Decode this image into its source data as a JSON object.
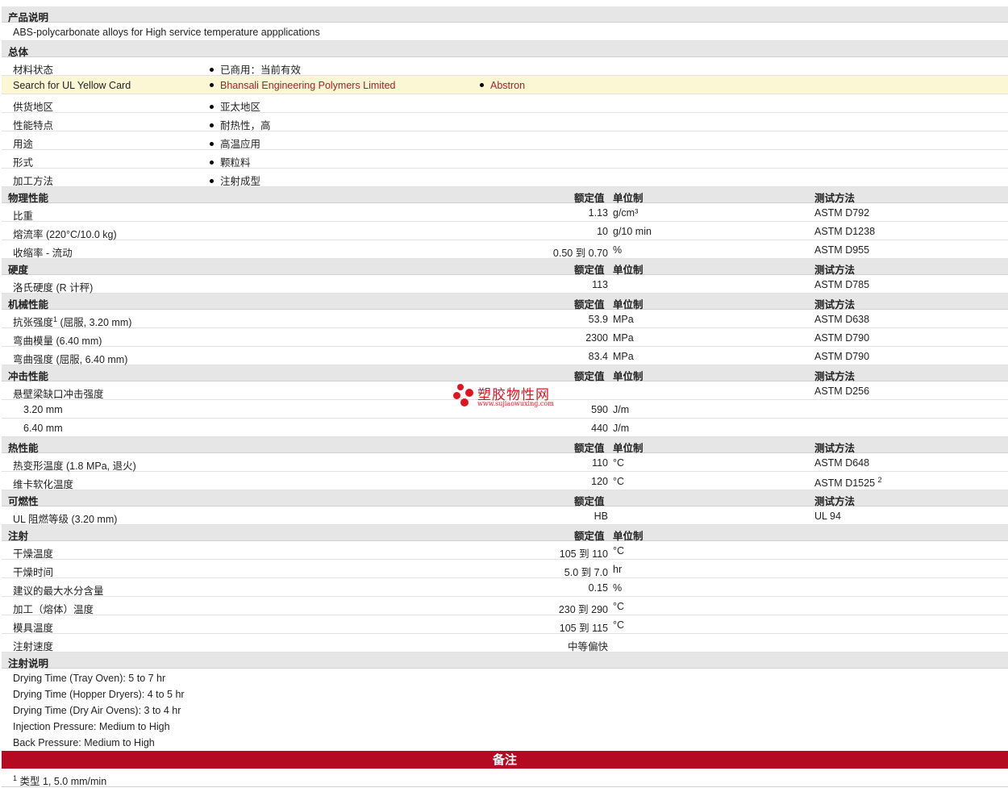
{
  "description": {
    "header": "产品说明",
    "text": "ABS-polycarbonate alloys for High service temperature appplications"
  },
  "general": {
    "header": "总体",
    "rows": [
      {
        "label": "材料状态",
        "b1": "已商用：当前有效"
      },
      {
        "label": "Search for UL Yellow Card",
        "b1": "Bhansali Engineering Polymers Limited",
        "b2": "Abstron"
      },
      {
        "label": "供货地区",
        "b1": "亚太地区"
      },
      {
        "label": "性能特点",
        "b1": "耐热性，高"
      },
      {
        "label": "用途",
        "b1": "高温应用"
      },
      {
        "label": "形式",
        "b1": "颗粒料"
      },
      {
        "label": "加工方法",
        "b1": "注射成型"
      }
    ]
  },
  "cols": {
    "value": "额定值",
    "unit": "单位制",
    "method": "测试方法"
  },
  "physical": {
    "header": "物理性能",
    "rows": [
      {
        "label": "比重",
        "value": "1.13",
        "unit": "g/cm³",
        "method": "ASTM D792"
      },
      {
        "label": "熔流率  (220°C/10.0 kg)",
        "value": "10",
        "unit": "g/10 min",
        "method": "ASTM D1238"
      },
      {
        "label": "收缩率  - 流动",
        "value": "0.50 到  0.70",
        "unit": "%",
        "method": "ASTM D955"
      }
    ]
  },
  "hardness": {
    "header": "硬度",
    "rows": [
      {
        "label": "洛氏硬度  (R 计秤)",
        "value": "113",
        "unit": "",
        "method": "ASTM D785"
      }
    ]
  },
  "mechanical": {
    "header": "机械性能",
    "rows": [
      {
        "label": "抗张强度",
        "sup": "1",
        "label_suffix": " (屈服, 3.20 mm)",
        "value": "53.9",
        "unit": "MPa",
        "method": "ASTM D638"
      },
      {
        "label": "弯曲模量  (6.40 mm)",
        "value": "2300",
        "unit": "MPa",
        "method": "ASTM D790"
      },
      {
        "label": "弯曲强度  (屈服, 6.40 mm)",
        "value": "83.4",
        "unit": "MPa",
        "method": "ASTM D790"
      }
    ]
  },
  "impact": {
    "header": "冲击性能",
    "rows": [
      {
        "label": "悬壁梁缺口冲击强度",
        "value": "",
        "unit": "",
        "method": "ASTM D256"
      },
      {
        "label": "3.20 mm",
        "value": "590",
        "unit": "J/m",
        "method": ""
      },
      {
        "label": "6.40 mm",
        "value": "440",
        "unit": "J/m",
        "method": ""
      }
    ]
  },
  "thermal": {
    "header": "热性能",
    "rows": [
      {
        "label": "热变形温度  (1.8 MPa, 退火)",
        "value": "110",
        "unit": "°C",
        "method": "ASTM D648"
      },
      {
        "label": "维卡软化温度",
        "value": "120",
        "unit": "°C",
        "method": "ASTM D1525",
        "msup": "2"
      }
    ]
  },
  "flammability": {
    "header": "可燃性",
    "rows": [
      {
        "label": "UL 阻燃等级  (3.20 mm)",
        "value": "HB",
        "unit": "",
        "method": "UL 94"
      }
    ]
  },
  "injection": {
    "header": "注射",
    "rows": [
      {
        "label": "干燥温度",
        "value": "105 到  110",
        "unit": "°C"
      },
      {
        "label": "干燥时间",
        "value": "5.0 到  7.0",
        "unit": "hr"
      },
      {
        "label": "建议的最大水分含量",
        "value": "0.15",
        "unit": "%"
      },
      {
        "label": "加工（熔体）温度",
        "value": "230 到  290",
        "unit": "°C"
      },
      {
        "label": "模具温度",
        "value": "105 到  115",
        "unit": "°C"
      },
      {
        "label": "注射速度",
        "value": "中等偏快",
        "unit": ""
      }
    ]
  },
  "injection_notes": {
    "header": "注射说明",
    "lines": [
      "Drying Time (Tray Oven): 5 to 7 hr",
      "Drying Time (Hopper Dryers): 4 to 5 hr",
      "Drying Time (Dry Air Ovens): 3 to 4 hr",
      "Injection Pressure: Medium to High",
      "Back Pressure: Medium to High"
    ]
  },
  "remarks": {
    "header": "备注",
    "note1_num": "1",
    "note1_text": "类型  1, 5.0 mm/min"
  },
  "watermark": {
    "title": "塑胶物性网",
    "url": "www.sujiaowuxing.com"
  }
}
